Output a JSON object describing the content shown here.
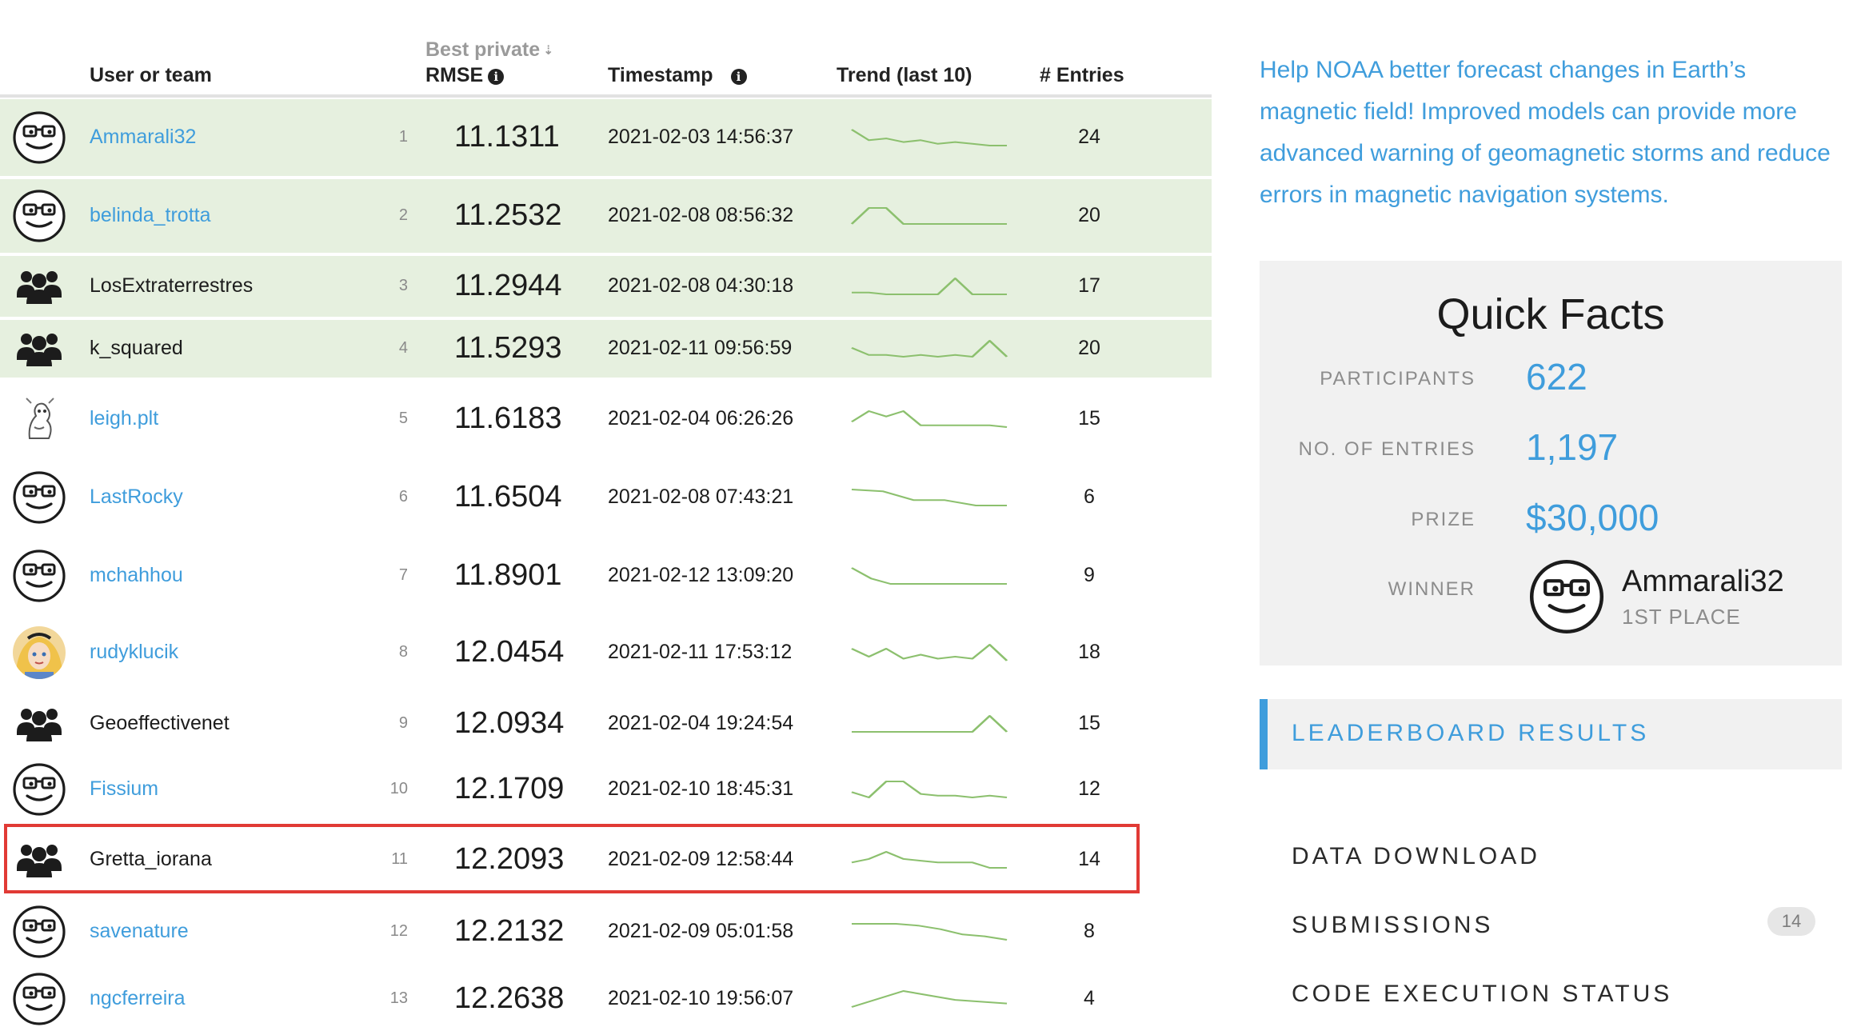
{
  "table": {
    "headers": {
      "user": "User or team",
      "best_private": "Best private",
      "rmse": "RMSE",
      "timestamp": "Timestamp",
      "trend": "Trend (last 10)",
      "entries": "# Entries"
    },
    "rows": [
      {
        "rank": "1",
        "name": "Ammarali32",
        "score": "11.1311",
        "timestamp": "2021-02-03 14:56:37",
        "entries": "24",
        "avatar": "face-icon",
        "link": true,
        "top": true,
        "trend": [
          9,
          3,
          4,
          2,
          3,
          1,
          2,
          1,
          0,
          0
        ]
      },
      {
        "rank": "2",
        "name": "belinda_trotta",
        "score": "11.2532",
        "timestamp": "2021-02-08 08:56:32",
        "entries": "20",
        "avatar": "face-icon",
        "link": true,
        "top": true,
        "trend": [
          0,
          9,
          9,
          0,
          0,
          0,
          0,
          0,
          0,
          0
        ]
      },
      {
        "rank": "3",
        "name": "LosExtraterrestres",
        "score": "11.2944",
        "timestamp": "2021-02-08 04:30:18",
        "entries": "17",
        "avatar": "team-icon",
        "link": false,
        "top": true,
        "trend": [
          1,
          1,
          0,
          0,
          0,
          0,
          9,
          0,
          0,
          0
        ]
      },
      {
        "rank": "4",
        "name": "k_squared",
        "score": "11.5293",
        "timestamp": "2021-02-11 09:56:59",
        "entries": "20",
        "avatar": "team-icon",
        "link": false,
        "top": true,
        "trend": [
          5,
          1,
          1,
          0,
          1,
          0,
          1,
          0,
          9,
          0
        ]
      },
      {
        "rank": "5",
        "name": "leigh.plt",
        "score": "11.6183",
        "timestamp": "2021-02-04 06:26:26",
        "entries": "15",
        "avatar": "sketch-avatar-icon",
        "link": true,
        "top": false,
        "trend": [
          3,
          9,
          6,
          9,
          1,
          1,
          1,
          1,
          1,
          0
        ]
      },
      {
        "rank": "6",
        "name": "LastRocky",
        "score": "11.6504",
        "timestamp": "2021-02-08 07:43:21",
        "entries": "6",
        "avatar": "face-icon",
        "link": true,
        "top": false,
        "trend": [
          9,
          8,
          3,
          3,
          0,
          0
        ]
      },
      {
        "rank": "7",
        "name": "mchahhou",
        "score": "11.8901",
        "timestamp": "2021-02-12 13:09:20",
        "entries": "9",
        "avatar": "face-icon",
        "link": true,
        "top": false,
        "trend": [
          9,
          3,
          0,
          0,
          0,
          0,
          0,
          0,
          0
        ]
      },
      {
        "rank": "8",
        "name": "rudyklucik",
        "score": "12.0454",
        "timestamp": "2021-02-11 17:53:12",
        "entries": "18",
        "avatar": "photo-avatar-icon",
        "link": true,
        "top": false,
        "trend": [
          6,
          2,
          6,
          1,
          3,
          1,
          2,
          1,
          8,
          0
        ]
      },
      {
        "rank": "9",
        "name": "Geoeffectivenet",
        "score": "12.0934",
        "timestamp": "2021-02-04 19:24:54",
        "entries": "15",
        "avatar": "team-icon",
        "link": false,
        "top": false,
        "trend": [
          0,
          0,
          0,
          0,
          0,
          0,
          0,
          0,
          9,
          0
        ]
      },
      {
        "rank": "10",
        "name": "Fissium",
        "score": "12.1709",
        "timestamp": "2021-02-10 18:45:31",
        "entries": "12",
        "avatar": "face-icon",
        "link": true,
        "top": false,
        "trend": [
          3,
          0,
          9,
          9,
          2,
          1,
          1,
          0,
          1,
          0
        ]
      },
      {
        "rank": "11",
        "name": "Gretta_iorana",
        "score": "12.2093",
        "timestamp": "2021-02-09 12:58:44",
        "entries": "14",
        "avatar": "team-icon",
        "link": false,
        "top": false,
        "trend": [
          3,
          5,
          9,
          5,
          4,
          3,
          3,
          3,
          0,
          0
        ]
      },
      {
        "rank": "12",
        "name": "savenature",
        "score": "12.2132",
        "timestamp": "2021-02-09 05:01:58",
        "entries": "8",
        "avatar": "face-icon",
        "link": true,
        "top": false,
        "trend": [
          9,
          9,
          9,
          8,
          6,
          3,
          2,
          0
        ]
      },
      {
        "rank": "13",
        "name": "ngcferreira",
        "score": "12.2638",
        "timestamp": "2021-02-10 19:56:07",
        "entries": "4",
        "avatar": "face-icon",
        "link": true,
        "top": false,
        "trend": [
          0,
          9,
          4,
          2
        ]
      }
    ],
    "trend_color": "#8cc06e"
  },
  "sidebar": {
    "blurb": "Help NOAA better forecast changes in Earth’s magnetic field! Improved models can provide more advanced warning of geomagnetic storms and reduce errors in magnetic navigation systems.",
    "quick_facts": {
      "title": "Quick Facts",
      "participants_label": "PARTICIPANTS",
      "participants": "622",
      "entries_label": "NO. OF ENTRIES",
      "entries": "1,197",
      "prize_label": "PRIZE",
      "prize": "$30,000",
      "winner_label": "WINNER",
      "winner_name": "Ammarali32",
      "winner_place": "1ST PLACE"
    },
    "nav": {
      "leaderboard": "LEADERBOARD RESULTS",
      "data_download": "DATA DOWNLOAD",
      "submissions": "SUBMISSIONS",
      "submissions_count": "14",
      "code_execution": "CODE EXECUTION STATUS"
    }
  },
  "colors": {
    "accent": "#3f9ddc",
    "top_row_bg": "#e6f0df",
    "highlight_border": "#e13a35"
  }
}
